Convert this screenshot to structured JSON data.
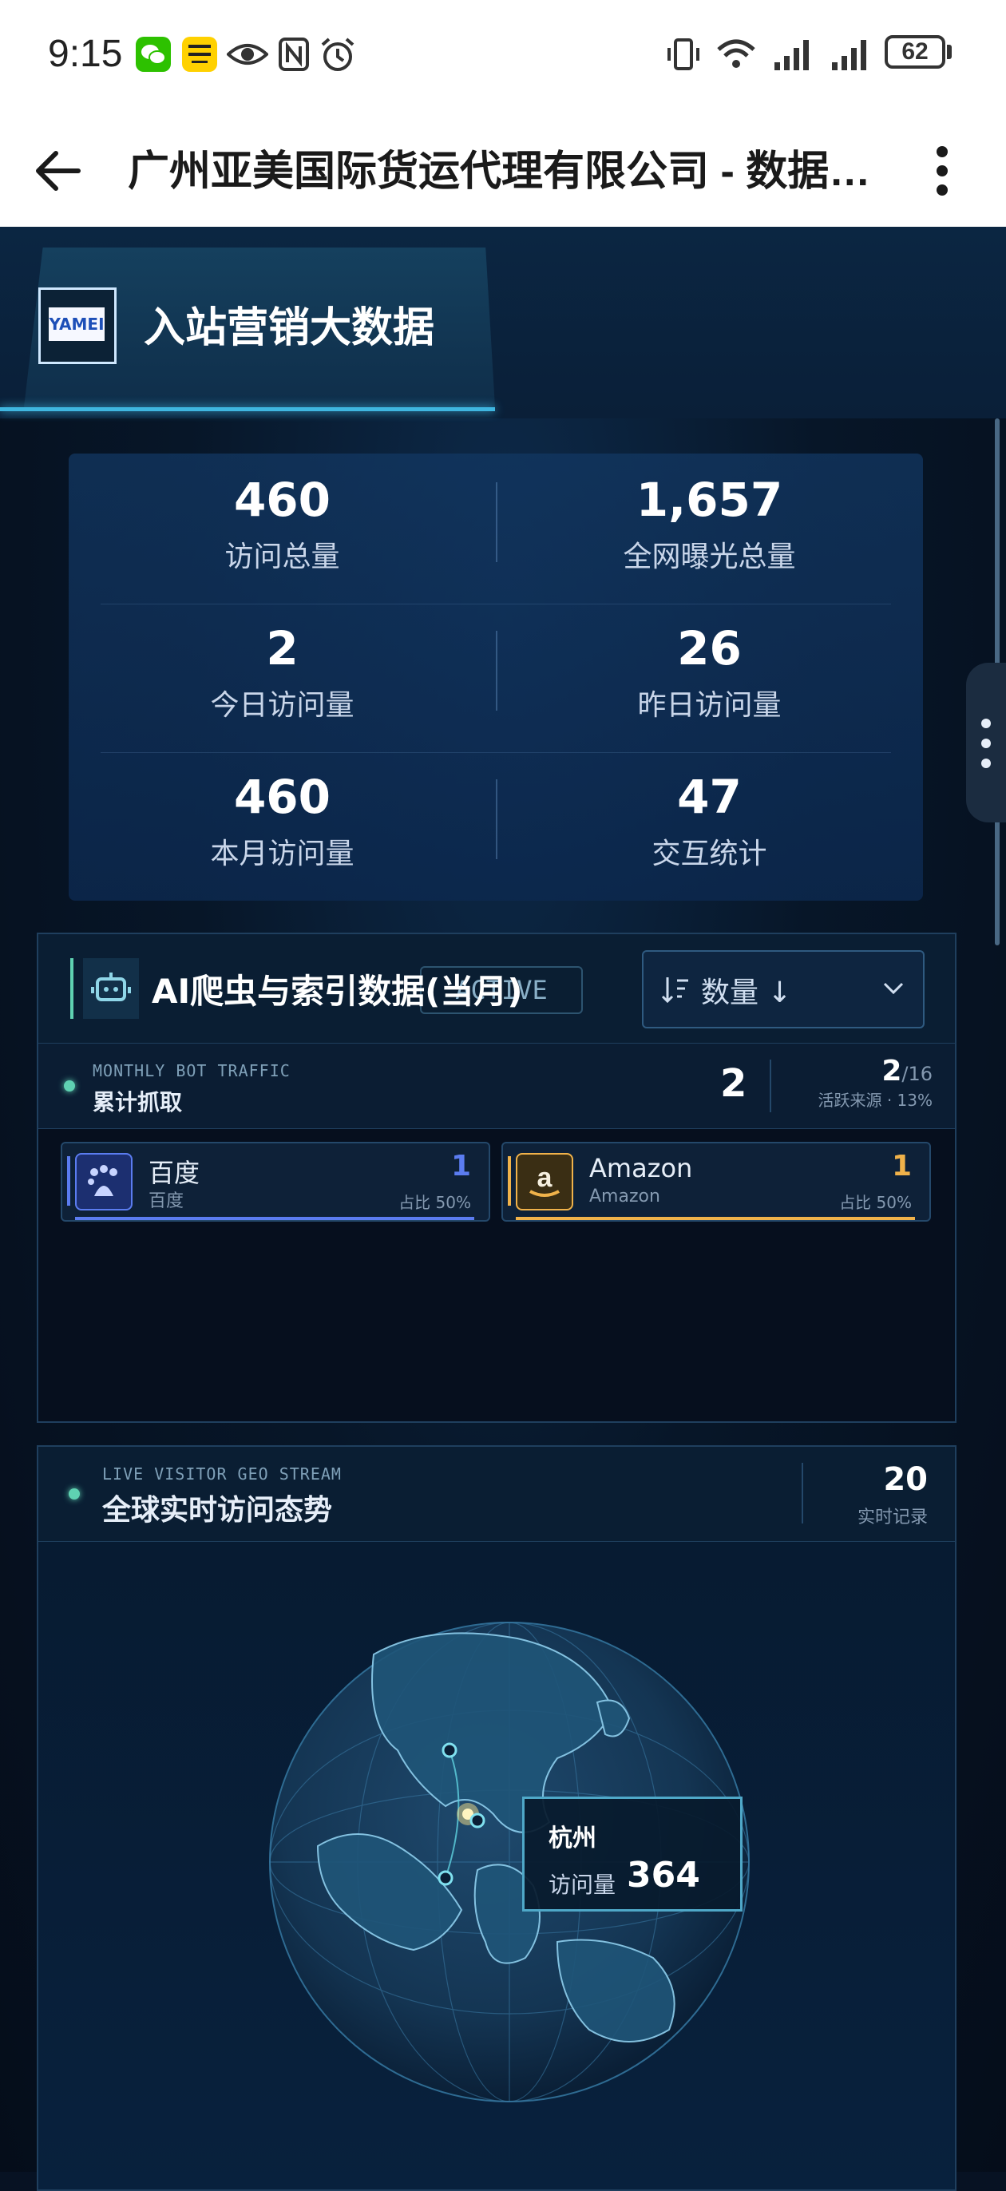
{
  "status_bar": {
    "time": "9:15",
    "battery": "62",
    "icons": [
      "wechat-icon",
      "meituan-icon",
      "eye-icon",
      "nfc-icon",
      "alarm-icon",
      "vibrate-icon",
      "wifi-icon",
      "signal-icon",
      "signal-icon",
      "battery-icon"
    ]
  },
  "app_bar": {
    "title": "广州亚美国际货运代理有限公司 - 数据中心",
    "back_icon": "arrow-left-icon",
    "more_icon": "more-vertical-icon"
  },
  "header": {
    "logo_text": "YAMEI",
    "title": "入站营销大数据"
  },
  "stats": [
    {
      "value": "460",
      "label": "访问总量"
    },
    {
      "value": "1,657",
      "label": "全网曝光总量"
    },
    {
      "value": "2",
      "label": "今日访问量"
    },
    {
      "value": "26",
      "label": "昨日访问量"
    },
    {
      "value": "460",
      "label": "本月访问量"
    },
    {
      "value": "47",
      "label": "交互统计"
    }
  ],
  "ai_panel": {
    "title": "AI爬虫与索引数据(当月)",
    "tag": "ACTIVE",
    "sort_label": "数量 ↓",
    "sub_caption": "MONTHLY BOT TRAFFIC",
    "sub_title": "累计抓取",
    "total": "2",
    "sources_active": "2",
    "sources_total": "/16",
    "sources_note": "活跃来源 · 13%",
    "bots": [
      {
        "name": "百度",
        "sub": "百度",
        "count": "1",
        "pct": "占比 50%",
        "color": "#5b7cf0",
        "icon": "baidu-icon"
      },
      {
        "name": "Amazon",
        "sub": "Amazon",
        "count": "1",
        "pct": "占比 50%",
        "color": "#f0b24a",
        "icon": "amazon-icon"
      }
    ]
  },
  "geo_panel": {
    "caption": "LIVE VISITOR GEO STREAM",
    "title": "全球实时访问态势",
    "count": "20",
    "count_label": "实时记录",
    "tooltip_city": "杭州",
    "tooltip_label": "访问量",
    "tooltip_value": "364"
  }
}
